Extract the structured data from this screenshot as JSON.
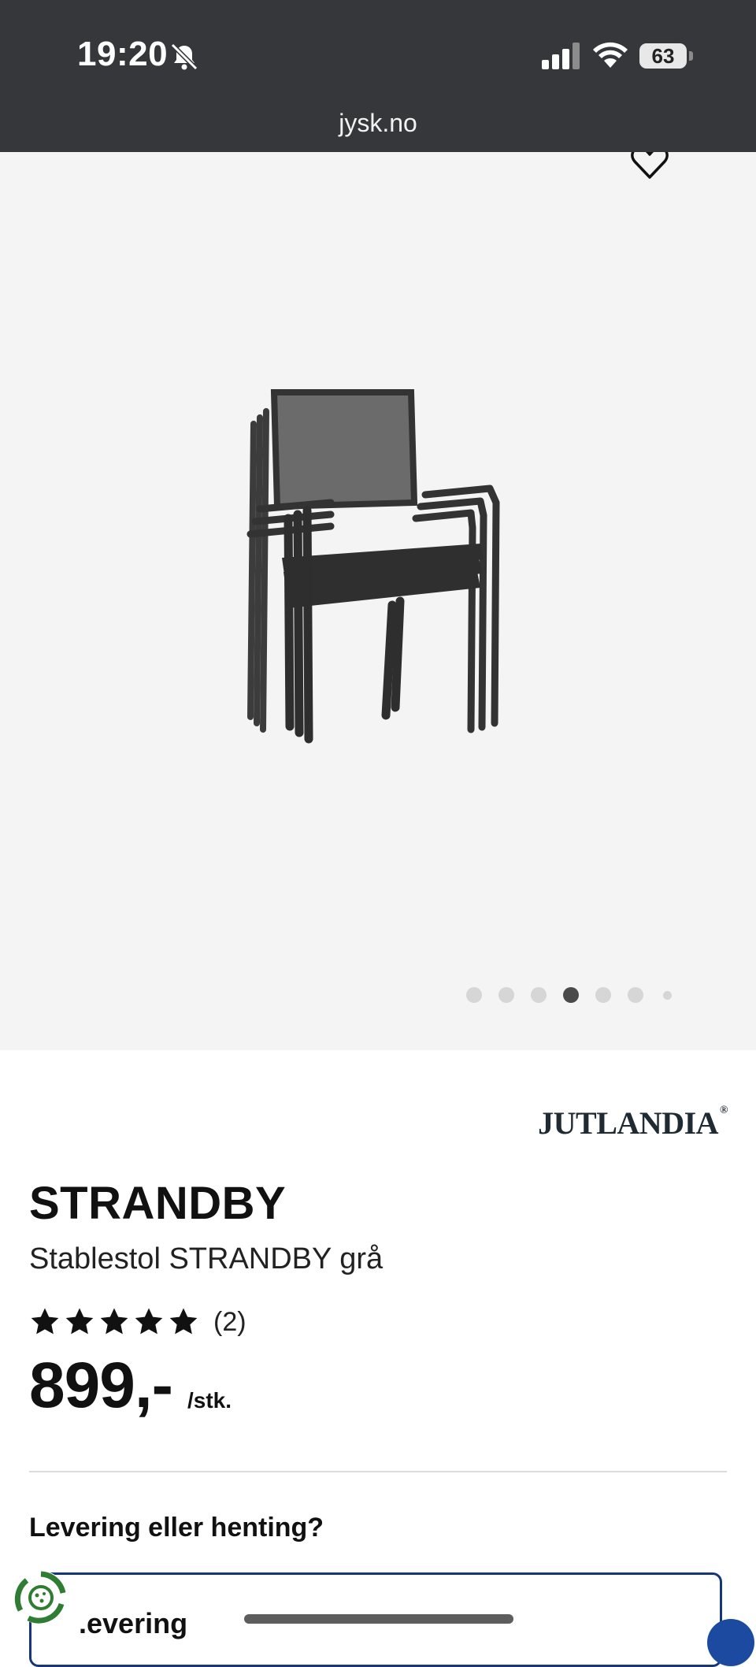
{
  "status_bar": {
    "time": "19:20",
    "battery": "63",
    "icons": [
      "bell-slash-icon",
      "signal-icon",
      "wifi-icon",
      "battery-icon"
    ]
  },
  "browser": {
    "url": "jysk.no"
  },
  "gallery": {
    "image_count": 7,
    "active_index": 4,
    "icons": [
      "heart-icon"
    ]
  },
  "product": {
    "brand": "JUTLANDIA",
    "name": "STRANDBY",
    "description": "Stablestol STRANDBY grå",
    "rating": 5,
    "rating_count": "(2)",
    "price": "899,-",
    "unit": "/stk."
  },
  "delivery": {
    "heading": "Levering eller henting?",
    "option_label": ".evering"
  },
  "colors": {
    "topbar": "#35373b",
    "gallery_bg": "#f4f4f4",
    "accent_blue": "#16367a",
    "eco_green": "#2e7d32"
  }
}
